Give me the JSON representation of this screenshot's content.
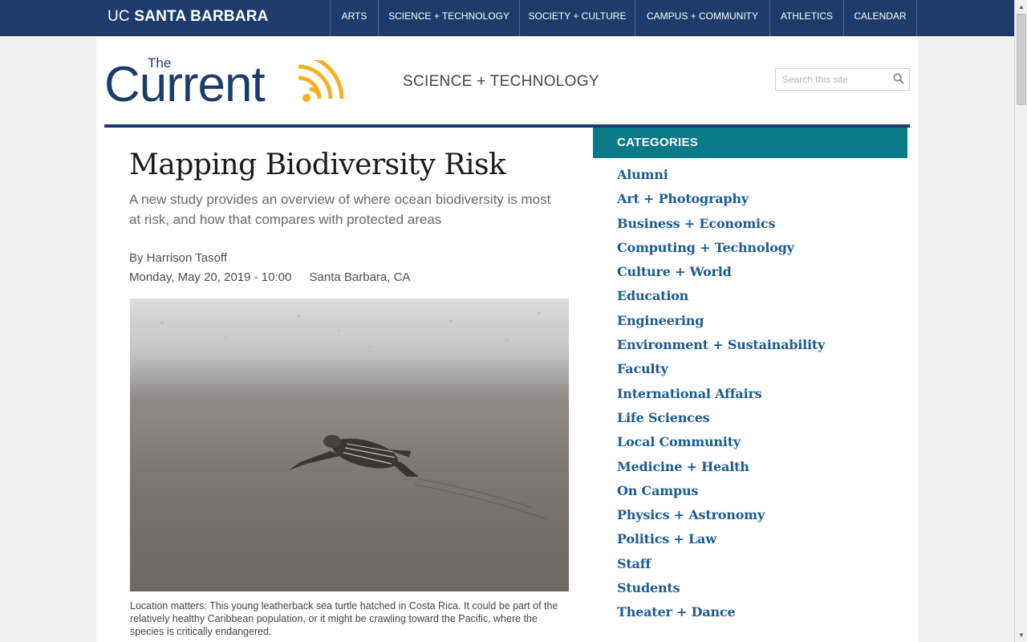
{
  "header": {
    "brand_prefix": "UC",
    "brand_name": "SANTA BARBARA",
    "nav": [
      {
        "label": "ARTS"
      },
      {
        "label": "SCIENCE + TECHNOLOGY"
      },
      {
        "label": "SOCIETY + CULTURE"
      },
      {
        "label": "CAMPUS + COMMUNITY"
      },
      {
        "label": "ATHLETICS"
      },
      {
        "label": "CALENDAR"
      }
    ]
  },
  "logo": {
    "the": "The",
    "current": "Current",
    "colors": {
      "navy": "#1c3d6b",
      "gold": "#f4b223"
    }
  },
  "section_title": "SCIENCE + TECHNOLOGY",
  "search": {
    "placeholder": "Search this site",
    "value": ""
  },
  "article": {
    "title": "Mapping Biodiversity Risk",
    "subtitle": "A new study provides an overview of where ocean biodiversity is most at risk, and how that compares with protected areas",
    "byline": "By Harrison Tasoff",
    "date": "Monday, May 20, 2019 - 10:00",
    "location": "Santa Barbara, CA",
    "caption": "Location matters: This young leatherback sea turtle hatched in Costa Rica. It could be part of the relatively healthy Caribbean population, or it might be crawling toward the Pacific, where the species is critically endangered."
  },
  "sidebar": {
    "header": "CATEGORIES",
    "items": [
      {
        "label": "Alumni"
      },
      {
        "label": "Art + Photography"
      },
      {
        "label": "Business + Economics"
      },
      {
        "label": "Computing + Technology"
      },
      {
        "label": "Culture + World"
      },
      {
        "label": "Education"
      },
      {
        "label": "Engineering"
      },
      {
        "label": "Environment + Sustainability"
      },
      {
        "label": "Faculty"
      },
      {
        "label": "International Affairs"
      },
      {
        "label": "Life Sciences"
      },
      {
        "label": "Local Community"
      },
      {
        "label": "Medicine + Health"
      },
      {
        "label": "On Campus"
      },
      {
        "label": "Physics + Astronomy"
      },
      {
        "label": "Politics + Law"
      },
      {
        "label": "Staff"
      },
      {
        "label": "Students"
      },
      {
        "label": "Theater + Dance"
      }
    ]
  },
  "colors": {
    "navy": "#1c3d6b",
    "teal": "#087986",
    "link": "#1a5b93"
  },
  "icons": {
    "search": "magnifier-icon",
    "scroll_up": "arrow-up-icon",
    "scroll_down": "arrow-down-icon"
  }
}
